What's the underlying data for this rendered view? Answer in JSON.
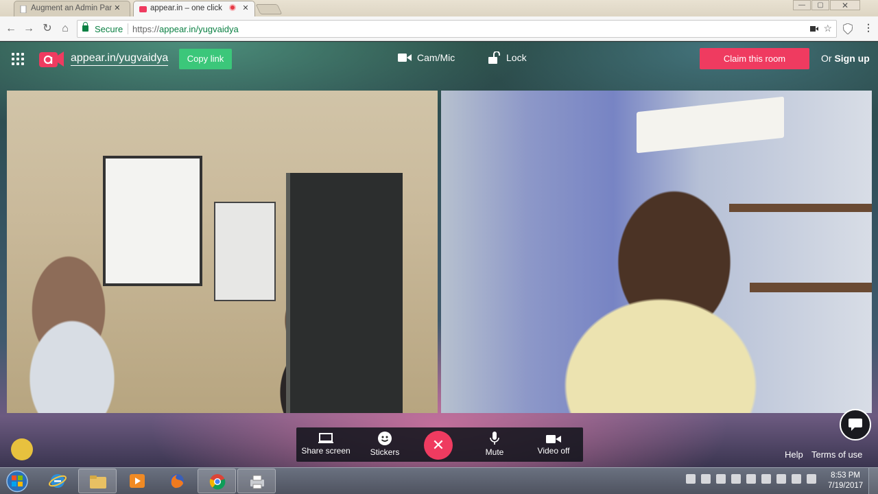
{
  "browser": {
    "tabs": [
      {
        "title": "Augment an Admin Pane",
        "active": false
      },
      {
        "title": "appear.in – one click",
        "active": true
      }
    ],
    "close_glyph": "✕",
    "secure_label": "Secure",
    "url_scheme": "https://",
    "url_rest": "appear.in/yugvaidya",
    "window_controls": {
      "minimize": "—",
      "maximize": "▢",
      "close": "✕"
    }
  },
  "app": {
    "room_name": "appear.in/yugvaidya",
    "copy_link_label": "Copy link",
    "cam_mic_label": "Cam/Mic",
    "lock_label": "Lock",
    "claim_label": "Claim this room",
    "or_label": "Or",
    "signup_label": "Sign up",
    "toolbar": {
      "share_screen": "Share screen",
      "stickers": "Stickers",
      "hangup_glyph": "✕",
      "mute": "Mute",
      "video_off": "Video off"
    },
    "help_label": "Help",
    "terms_label": "Terms of use",
    "colors": {
      "brand": "#ef3b60",
      "copy_link": "#3bc77a",
      "secure": "#0b8043"
    }
  },
  "taskbar": {
    "time": "8:53 PM",
    "date": "7/19/2017"
  }
}
